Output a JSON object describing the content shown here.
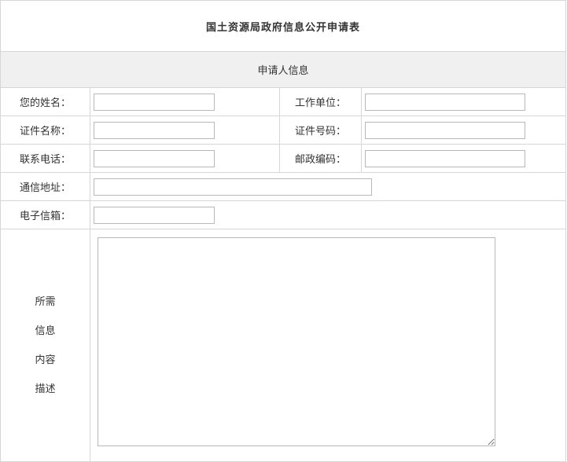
{
  "form": {
    "title": "国土资源局政府信息公开申请表",
    "section_header": "申请人信息",
    "fields": {
      "name_label": "您的姓名：",
      "name_value": "",
      "work_unit_label": "工作单位：",
      "work_unit_value": "",
      "id_type_label": "证件名称：",
      "id_type_value": "",
      "id_number_label": "证件号码：",
      "id_number_value": "",
      "phone_label": "联系电话：",
      "phone_value": "",
      "postal_code_label": "邮政编码：",
      "postal_code_value": "",
      "address_label": "通信地址：",
      "address_value": "",
      "email_label": "电子信箱：",
      "email_value": ""
    },
    "description": {
      "label_lines": [
        "所需",
        "信息",
        "内容",
        "描述"
      ],
      "value": ""
    }
  }
}
